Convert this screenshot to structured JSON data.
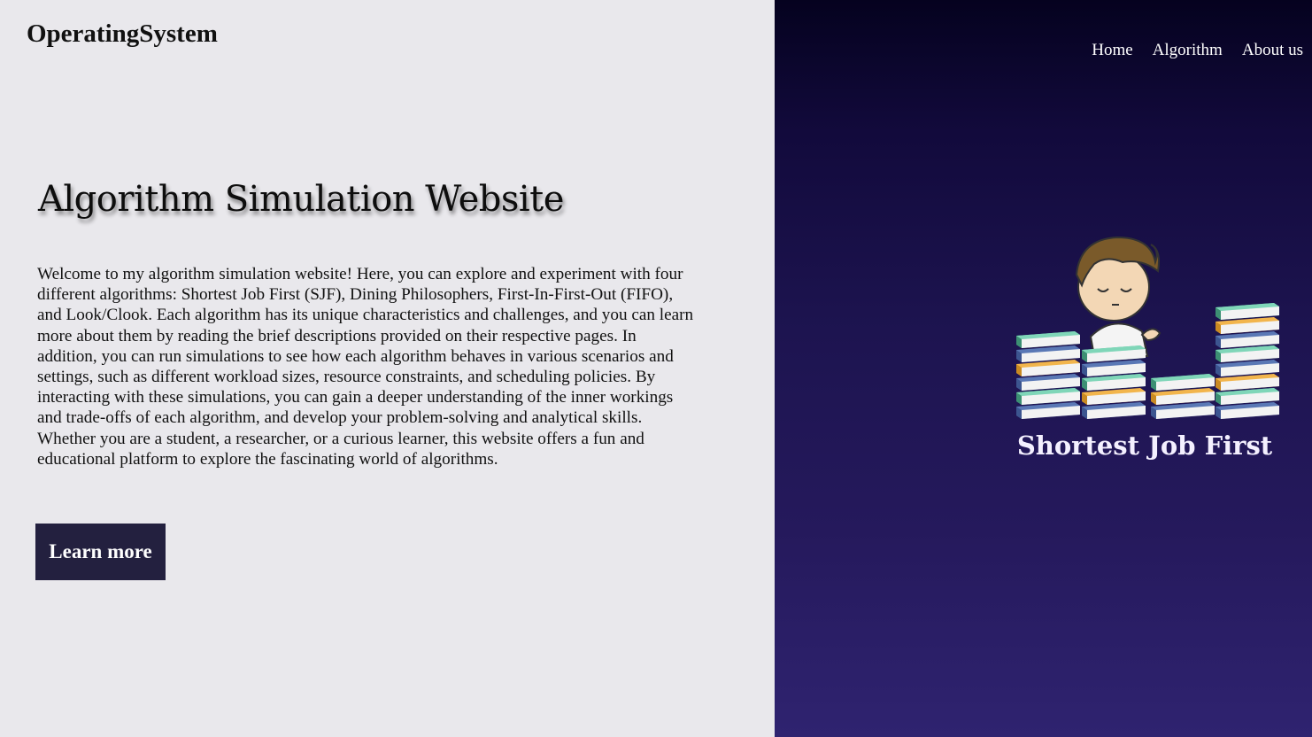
{
  "header": {
    "brand": "OperatingSystem",
    "nav": [
      {
        "label": "Home"
      },
      {
        "label": "Algorithm"
      },
      {
        "label": "About us"
      }
    ]
  },
  "hero": {
    "title": "Algorithm Simulation Website",
    "description": "Welcome to my algorithm simulation website! Here, you can explore and experiment with four different algorithms: Shortest Job First (SJF), Dining Philosophers, First-In-First-Out (FIFO), and Look/Clook. Each algorithm has its unique characteristics and challenges, and you can learn more about them by reading the brief descriptions provided on their respective pages. In addition, you can run simulations to see how each algorithm behaves in various scenarios and settings, such as different workload sizes, resource constraints, and scheduling policies. By interacting with these simulations, you can gain a deeper understanding of the inner workings and trade-offs of each algorithm, and develop your problem-solving and analytical skills. Whether you are a student, a researcher, or a curious learner, this website offers a fun and educational platform to explore the fascinating world of algorithms.",
    "cta_label": "Learn more"
  },
  "feature": {
    "caption": "Shortest Job First",
    "illustration": "boy-with-book-stacks-illustration"
  },
  "colors": {
    "left_bg": "#e9e8ec",
    "right_bg_top": "#05021f",
    "right_bg_bottom": "#2f2370",
    "button_bg": "#23203f",
    "book_teal": "#5bbf9f",
    "book_blue": "#5a78b5",
    "book_orange": "#f2b54c"
  }
}
